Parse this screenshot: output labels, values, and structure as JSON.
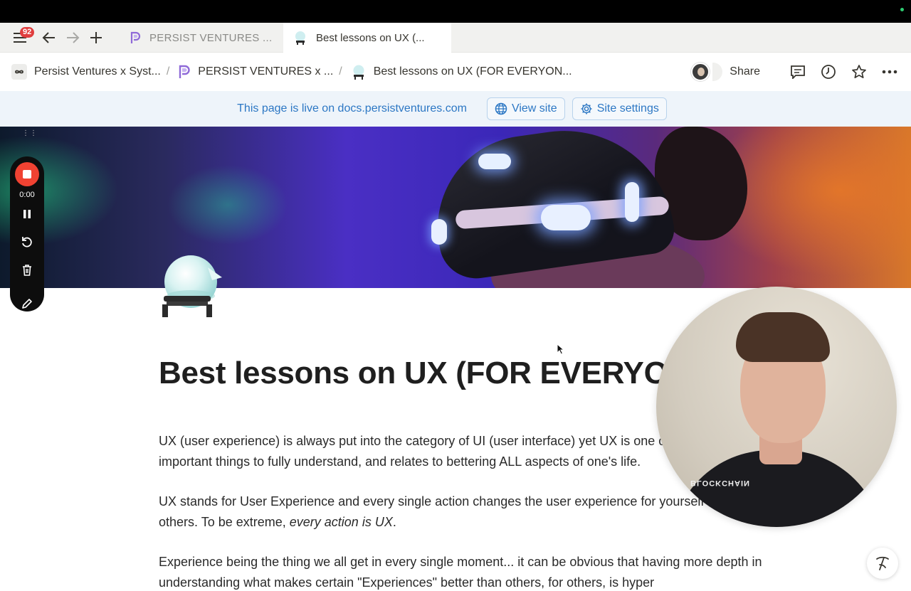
{
  "browser": {
    "notification_count": "92",
    "tabs": [
      {
        "label": "PERSIST VENTURES ...",
        "active": false
      },
      {
        "label": "Best lessons on UX (...",
        "active": true
      }
    ]
  },
  "breadcrumbs": [
    {
      "label": "Persist Ventures x Syst...",
      "icon": "infinity-icon"
    },
    {
      "label": "PERSIST VENTURES x ...",
      "icon": "persist-logo-icon"
    },
    {
      "label": "Best lessons on UX (FOR EVERYON...",
      "icon": "crystal-ball-icon"
    }
  ],
  "breadcrumb_separator": "/",
  "actions": {
    "share_label": "Share"
  },
  "live_banner": {
    "text": "This page is live on docs.persistventures.com",
    "view_site_label": "View site",
    "site_settings_label": "Site settings"
  },
  "recorder": {
    "time": "0:00"
  },
  "page": {
    "title": "Best lessons on UX (FOR EVERYO",
    "paragraphs": {
      "p1": "UX (user experience) is always put into the category of UI (user interface) yet UX is one of the most important things to fully understand, and relates to bettering ALL aspects of one's life.",
      "p2_start": "UX stands for User Experience and every single action changes the user experience for yourself and others. To be extreme, ",
      "p2_em": "every action is UX",
      "p2_end": ".",
      "p3": "Experience being the thing we all get in every single moment... it can be obvious that having more depth in understanding what makes certain \"Experiences\" better than others, for others, is hyper"
    }
  },
  "webcam": {
    "shirt_text": "BLOCKCHAIN"
  },
  "colors": {
    "accent_blue": "#2c77c4",
    "live_bar_bg": "#eef4fa",
    "record_red": "#f04232",
    "badge_red": "#e03e3e"
  }
}
